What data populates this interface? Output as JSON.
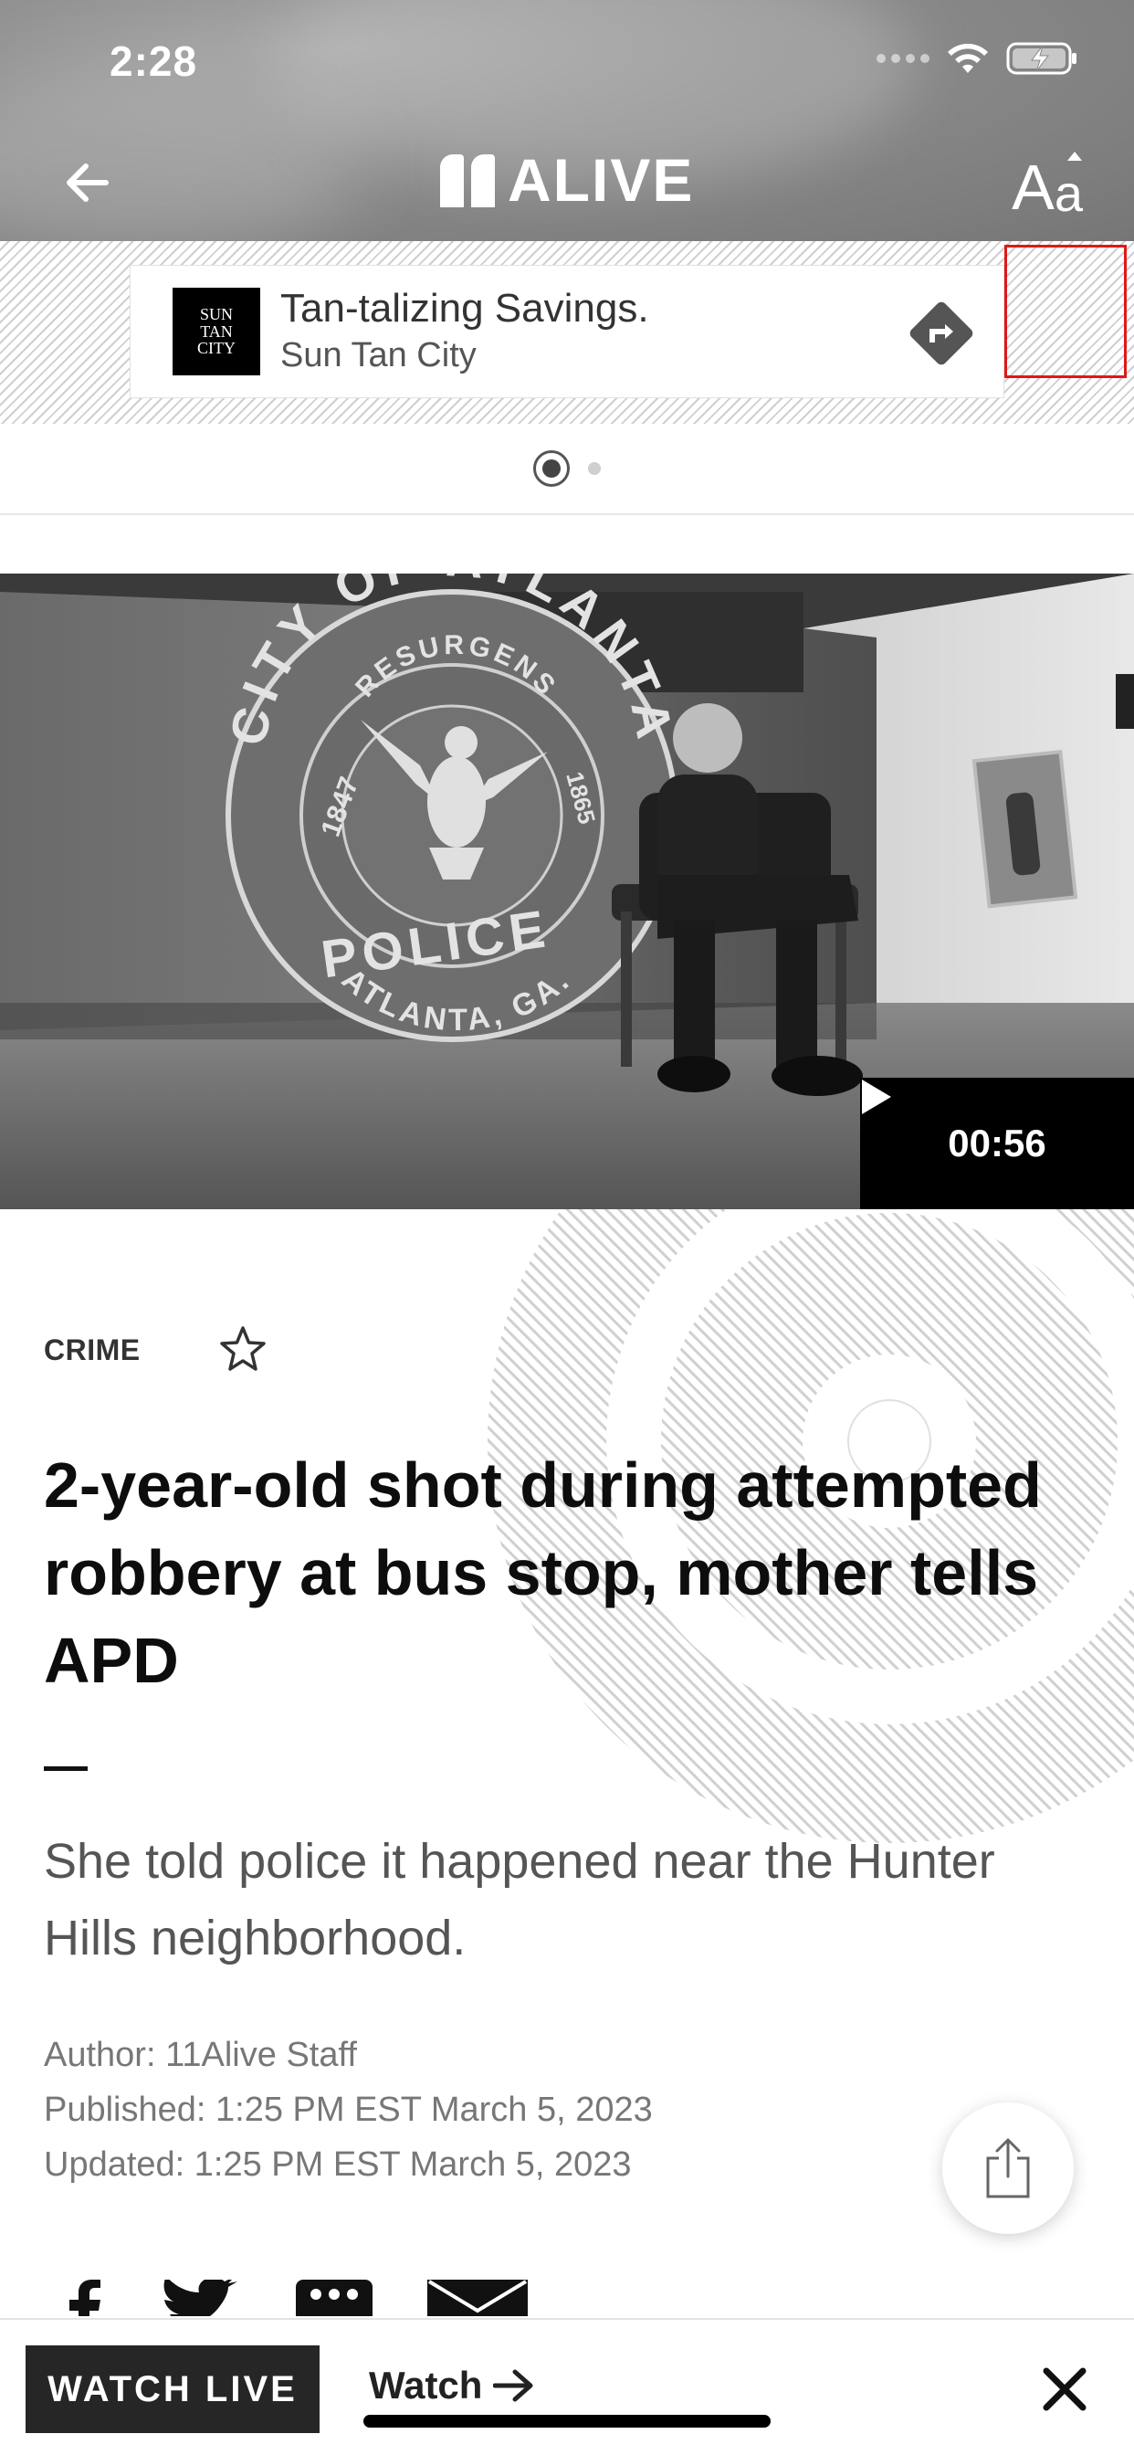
{
  "status_bar": {
    "time": "2:28"
  },
  "header": {
    "logo_text": "ALIVE",
    "font_button_big": "A",
    "font_button_small": "a"
  },
  "ad": {
    "logo_lines": [
      "SUN",
      "TAN",
      "CITY"
    ],
    "title": "Tan-talizing Savings.",
    "subtitle": "Sun Tan City"
  },
  "video": {
    "duration": "00:56"
  },
  "article": {
    "category": "CRIME",
    "headline": "2-year-old shot during attempted robbery at bus stop, mother tells APD",
    "summary": "She told police it happened near the Hunter Hills neighborhood.",
    "author": "Author: 11Alive Staff",
    "published": "Published: 1:25 PM EST March 5, 2023",
    "updated": "Updated: 1:25 PM EST March 5, 2023"
  },
  "seal": {
    "top_text": "CITY OF ATLANTA",
    "inner_text": "RESURGENS",
    "left_year": "1847",
    "right_year": "1865",
    "bottom_text": "ATLANTA, GA.",
    "police": "POLICE"
  },
  "bottom_bar": {
    "watch_live": "WATCH LIVE",
    "watch_link": "Watch"
  },
  "colors": {
    "ad_highlight": "#e01818",
    "watch_live_bg": "#262626"
  }
}
